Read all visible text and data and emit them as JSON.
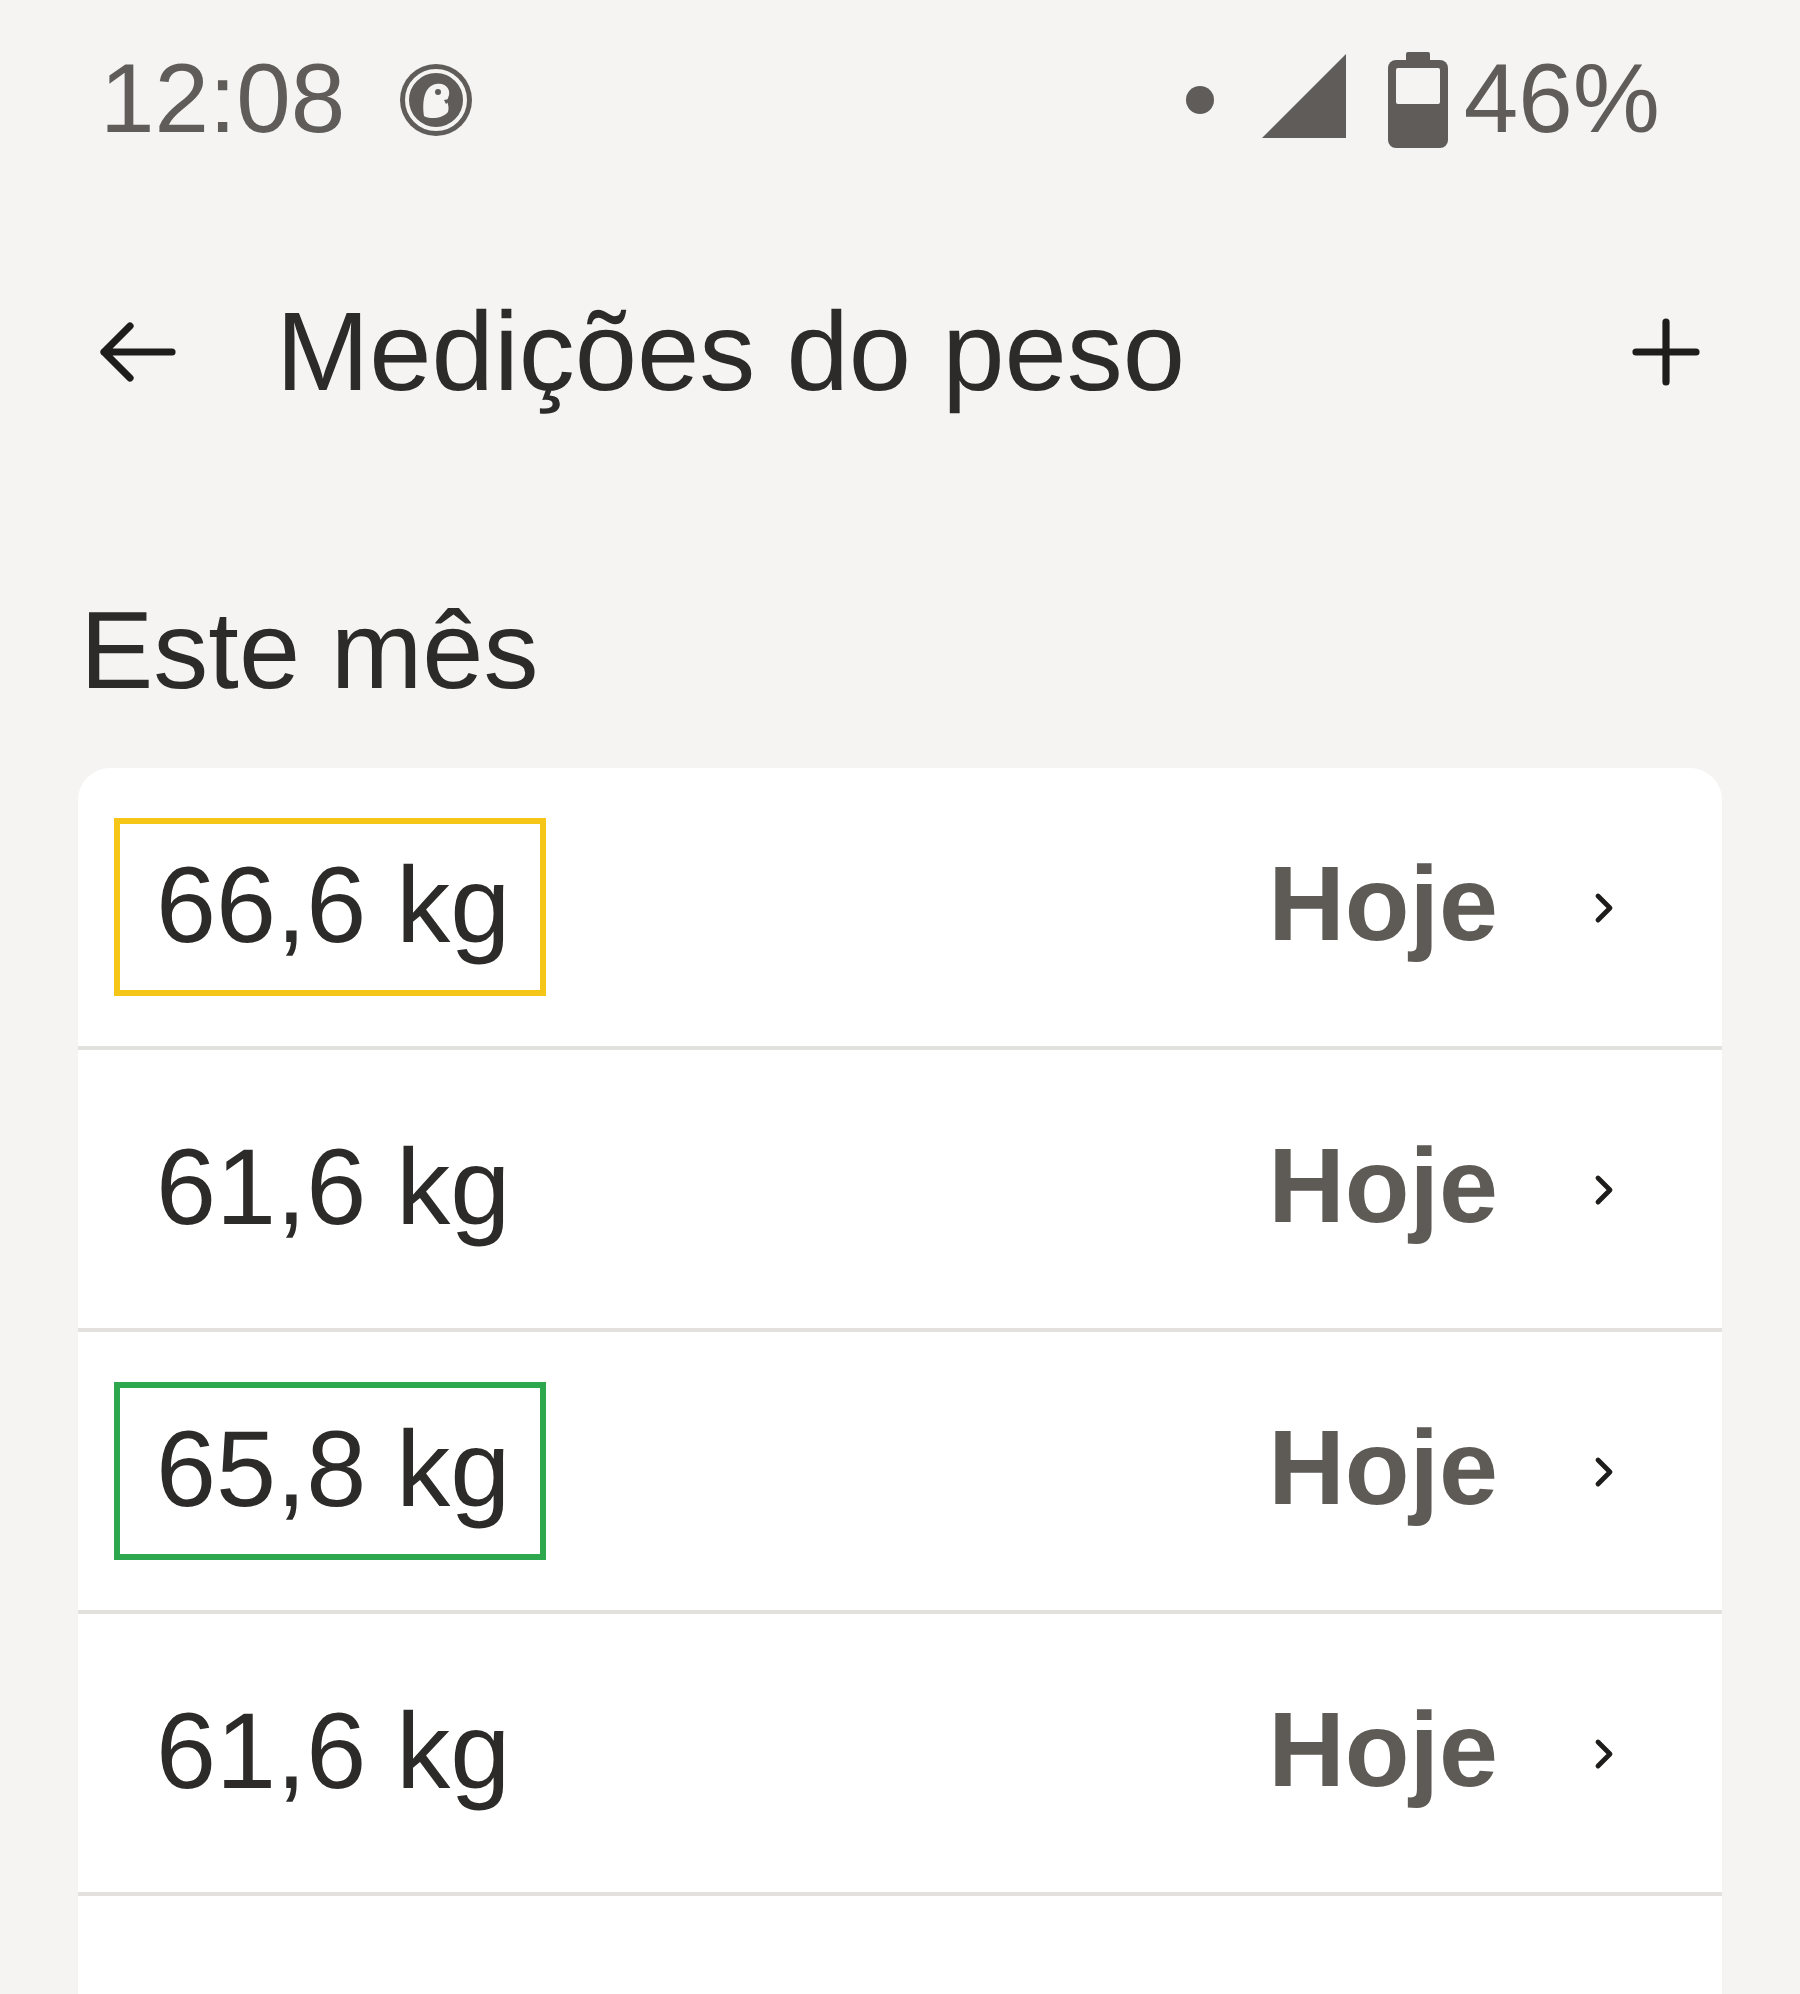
{
  "status_bar": {
    "time": "12:08",
    "battery": "46%"
  },
  "header": {
    "title": "Medições do peso"
  },
  "section": {
    "title": "Este mês"
  },
  "rows": [
    {
      "value": "66,6 kg",
      "date": "Hoje",
      "color": "#f5c518"
    },
    {
      "value": "61,6 kg",
      "date": "Hoje"
    },
    {
      "value": "65,8 kg",
      "date": "Hoje",
      "color": "#2ea84f"
    },
    {
      "value": "61,6 kg",
      "date": "Hoje"
    }
  ]
}
